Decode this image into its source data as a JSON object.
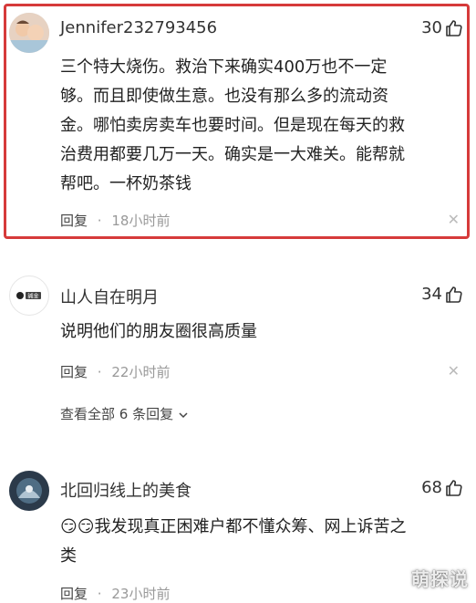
{
  "comments": [
    {
      "username": "Jennifer232793456",
      "likes": "30",
      "lines": [
        "三个特大烧伤。救治下来确实400万也不一定",
        "够。而且即使做生意。也没有那么多的流动资",
        "金。哪怕卖房卖车也要时间。但是现在每天的救",
        "治费用都要几万一天。确实是一大难关。能帮就",
        "帮吧。一杯奶茶钱"
      ],
      "reply_label": "回复",
      "separator": "·",
      "time": "18小时前"
    },
    {
      "username": "山人自在明月",
      "likes": "34",
      "lines": [
        "说明他们的朋友圈很高质量"
      ],
      "reply_label": "回复",
      "separator": "·",
      "time": "22小时前",
      "view_replies": "查看全部 6 条回复",
      "avatar_text": "誠金"
    },
    {
      "username": "北回归线上的美食",
      "likes": "68",
      "lines": [
        "😏😏我发现真正困难户都不懂众筹、网上诉苦之",
        "类"
      ],
      "reply_label": "回复",
      "separator": "·",
      "time": "23小时前"
    }
  ],
  "watermark": "萌探说",
  "icons": {
    "like": "thumbs-up-icon",
    "close": "close-icon",
    "expand": "chevron-down-icon"
  },
  "colors": {
    "highlight": "#d63a3a",
    "meta": "#999999"
  }
}
